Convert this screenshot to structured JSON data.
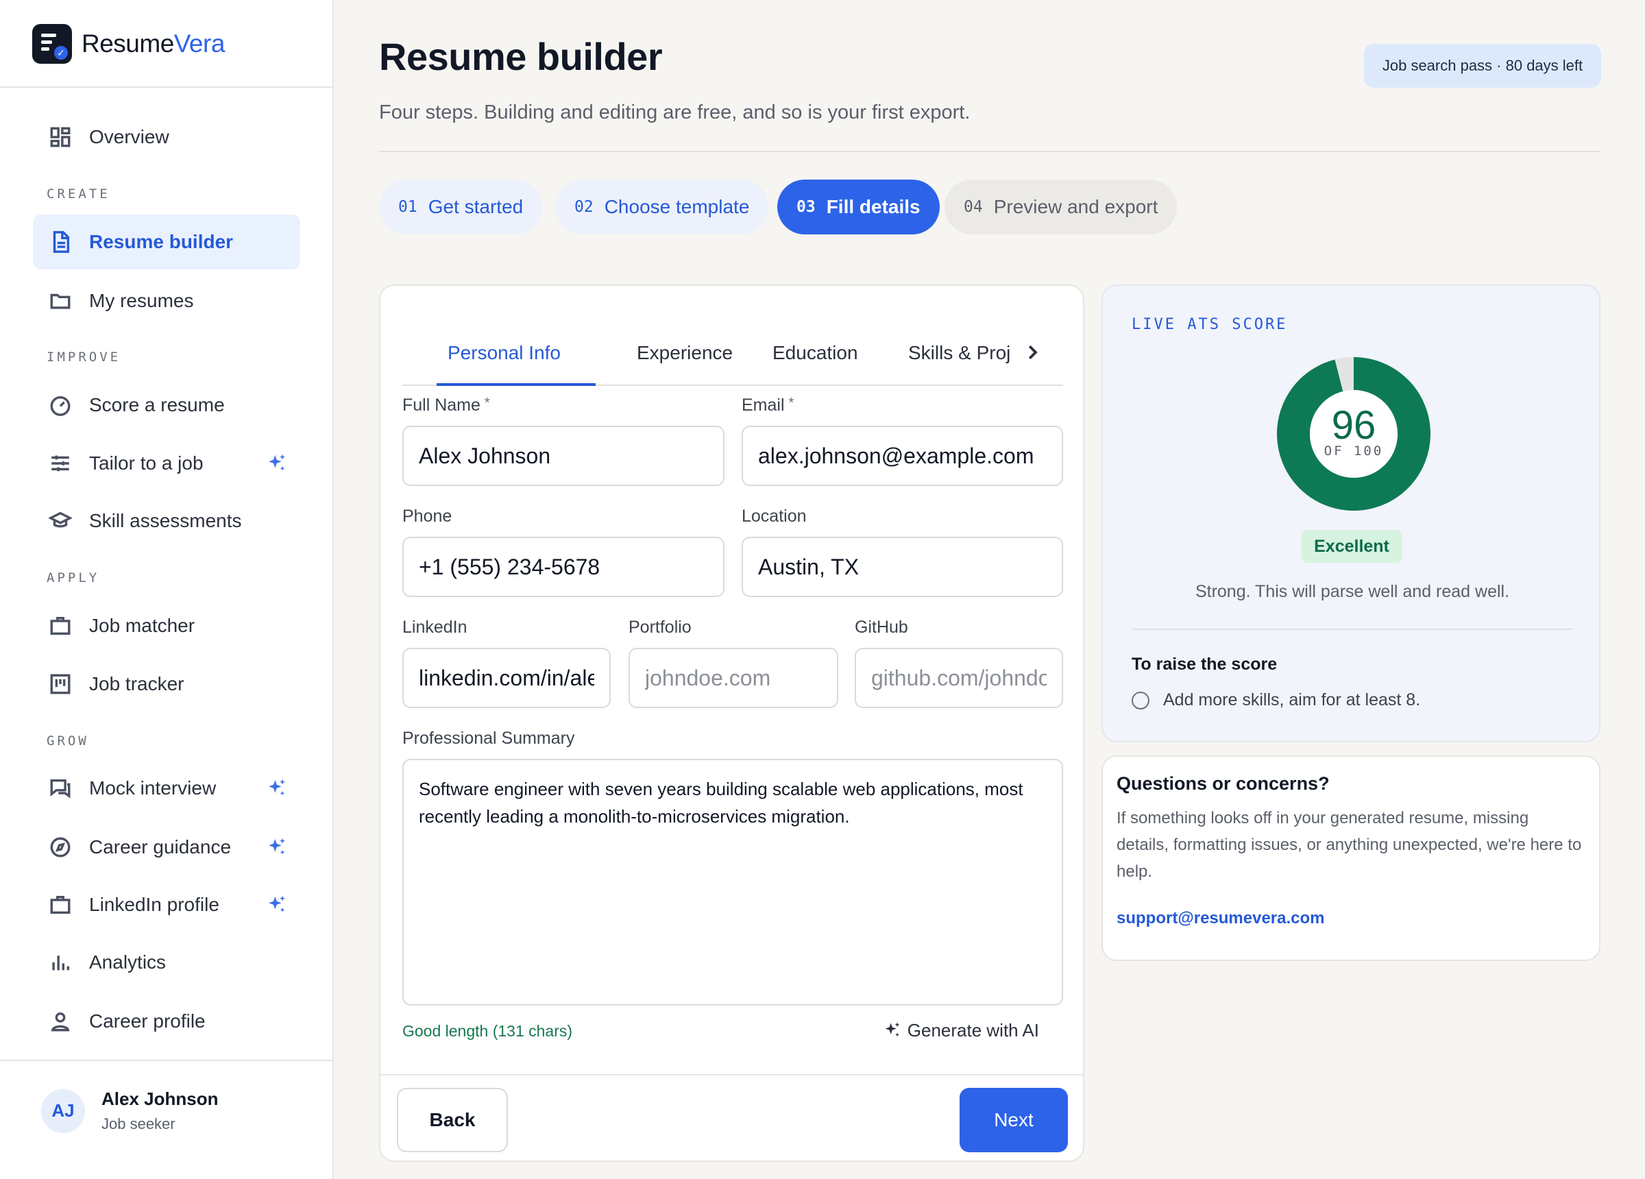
{
  "brand": {
    "name_main": "Resume",
    "name_accent": "Vera"
  },
  "sidebar": {
    "items": [
      {
        "label": "Overview",
        "icon": "dashboard-icon"
      },
      {
        "label": "Resume builder",
        "icon": "document-icon",
        "active": true
      },
      {
        "label": "My resumes",
        "icon": "folder-icon"
      },
      {
        "label": "Score a resume",
        "icon": "gauge-icon"
      },
      {
        "label": "Tailor to a job",
        "icon": "sliders-icon",
        "ai": true
      },
      {
        "label": "Skill assessments",
        "icon": "graduation-cap-icon"
      },
      {
        "label": "Job matcher",
        "icon": "briefcase-icon"
      },
      {
        "label": "Job tracker",
        "icon": "kanban-icon"
      },
      {
        "label": "Mock interview",
        "icon": "chat-icon",
        "ai": true
      },
      {
        "label": "Career guidance",
        "icon": "compass-icon",
        "ai": true
      },
      {
        "label": "LinkedIn profile",
        "icon": "briefcase-icon",
        "ai": true
      },
      {
        "label": "Analytics",
        "icon": "bar-chart-icon"
      },
      {
        "label": "Career profile",
        "icon": "user-icon"
      }
    ],
    "sections": [
      "CREATE",
      "IMPROVE",
      "APPLY",
      "GROW"
    ]
  },
  "user": {
    "initials": "AJ",
    "name": "Alex Johnson",
    "role": "Job seeker"
  },
  "header": {
    "title": "Resume builder",
    "subtitle": "Four steps. Building and editing are free, and so is your first export.",
    "pass": "Job search pass · 80 days left"
  },
  "steps": [
    {
      "num": "01",
      "label": "Get started",
      "state": "done"
    },
    {
      "num": "02",
      "label": "Choose template",
      "state": "done"
    },
    {
      "num": "03",
      "label": "Fill details",
      "state": "current"
    },
    {
      "num": "04",
      "label": "Preview and export",
      "state": "todo"
    }
  ],
  "tabs": [
    "Personal Info",
    "Experience",
    "Education",
    "Skills & Proj"
  ],
  "form": {
    "full_name_label": "Full Name",
    "full_name": "Alex Johnson",
    "email_label": "Email",
    "email": "alex.johnson@example.com",
    "phone_label": "Phone",
    "phone": "+1 (555) 234-5678",
    "location_label": "Location",
    "location": "Austin, TX",
    "linkedin_label": "LinkedIn",
    "linkedin": "linkedin.com/in/alexjohnson",
    "portfolio_label": "Portfolio",
    "portfolio_placeholder": "johndoe.com",
    "github_label": "GitHub",
    "github_placeholder": "github.com/johndoe",
    "summary_label": "Professional Summary",
    "summary": "Software engineer with seven years building scalable web applications, most recently leading a monolith-to-microservices migration.",
    "hint": "Good length (131 chars)",
    "generate": "Generate with AI",
    "required_mark": "*",
    "back": "Back",
    "next": "Next"
  },
  "ats": {
    "label": "LIVE ATS SCORE",
    "score": 96,
    "max": 100,
    "of_text": "OF 100",
    "rating": "Excellent",
    "description": "Strong. This will parse well and read well.",
    "raise_title": "To raise the score",
    "raise_items": [
      "Add more skills, aim for at least 8."
    ],
    "colors": {
      "ring": "#0d7a55",
      "track": "#e4e4e4"
    }
  },
  "help": {
    "title": "Questions or concerns?",
    "text": "If something looks off in your generated resume, missing details, formatting issues, or anything unexpected, we're here to help.",
    "email": "support@resumevera.com"
  }
}
